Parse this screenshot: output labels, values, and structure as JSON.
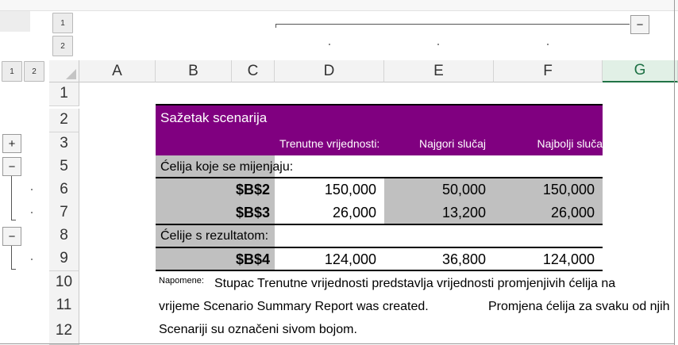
{
  "outline": {
    "col_levels": [
      "1",
      "2"
    ],
    "row_levels": [
      "1",
      "2"
    ],
    "collapse_symbol": "−",
    "expand_symbol": "+"
  },
  "columns": [
    "A",
    "B",
    "C",
    "D",
    "E",
    "F",
    "G"
  ],
  "selected_column": "G",
  "rows": [
    "1",
    "2",
    "3",
    "5",
    "6",
    "7",
    "8",
    "9",
    "10",
    "11",
    "12"
  ],
  "summary": {
    "title": "Sažetak scenarija",
    "headers": {
      "current": "Trenutne vrijednosti:",
      "worst": "Najgori slučaj",
      "best": "Najbolji sluča"
    },
    "changing_label": "Ćelija koje se mijenjaju:",
    "changing_rows": [
      {
        "ref": "$B$2",
        "current": "150,000",
        "worst": "50,000",
        "best": "150,000"
      },
      {
        "ref": "$B$3",
        "current": "26,000",
        "worst": "13,200",
        "best": "26,000"
      }
    ],
    "result_label": "Ćelije s rezultatom:",
    "result_rows": [
      {
        "ref": "$B$4",
        "current": "124,000",
        "worst": "36,800",
        "best": "124,000"
      }
    ]
  },
  "notes": {
    "label": "Napomene:",
    "line1": "Stupac Trenutne vrijednosti predstavlja vrijednosti promjenjivih ćelija na",
    "line2a": "vrijeme Scenario Summary Report was created.",
    "line2b": "Promjena ćelija za svaku od njih",
    "line3": "Scenariji su označeni sivom bojom."
  }
}
